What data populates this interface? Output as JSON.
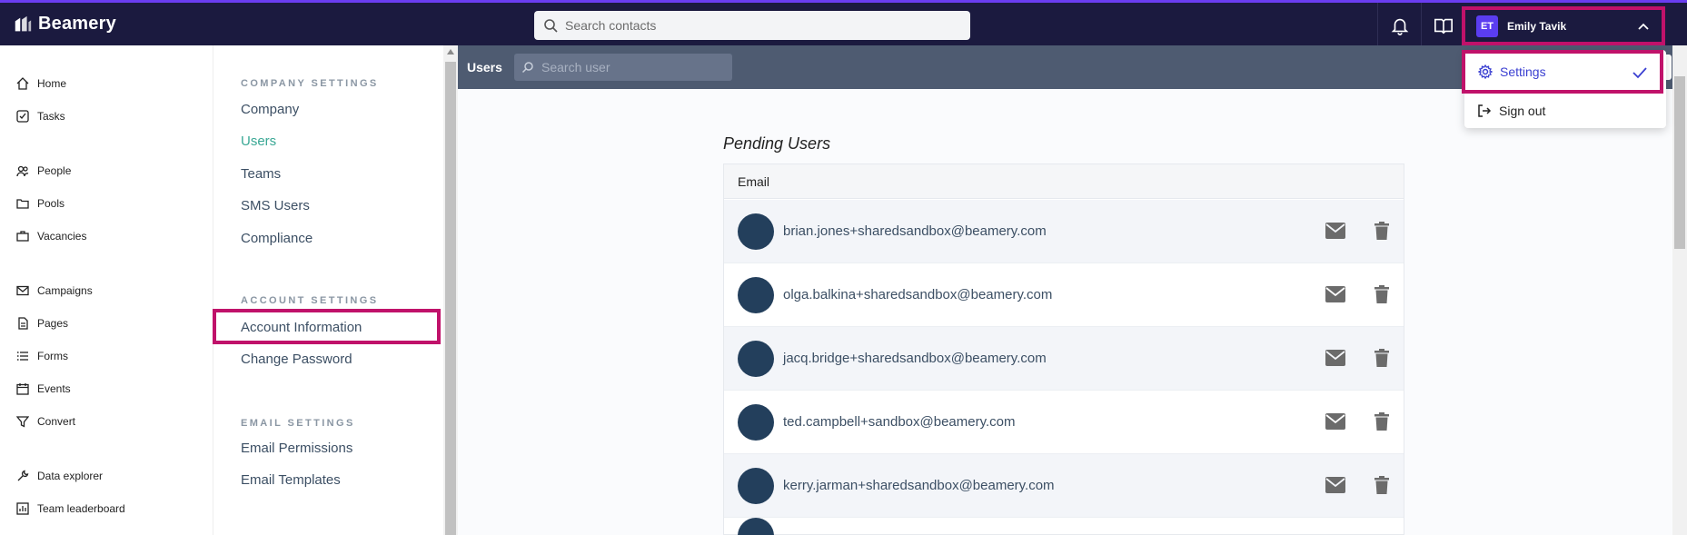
{
  "app": {
    "brand": "Beamery"
  },
  "topbar": {
    "search_placeholder": "Search contacts",
    "user": {
      "initials": "ET",
      "name": "Emily Tavik"
    }
  },
  "leftnav": {
    "items": [
      {
        "label": "Home",
        "icon": "home-icon"
      },
      {
        "label": "Tasks",
        "icon": "tasks-icon"
      },
      {
        "label": "People",
        "icon": "people-icon"
      },
      {
        "label": "Pools",
        "icon": "folder-icon"
      },
      {
        "label": "Vacancies",
        "icon": "briefcase-icon"
      },
      {
        "label": "Campaigns",
        "icon": "mail-icon"
      },
      {
        "label": "Pages",
        "icon": "page-icon"
      },
      {
        "label": "Forms",
        "icon": "list-icon"
      },
      {
        "label": "Events",
        "icon": "calendar-icon"
      },
      {
        "label": "Convert",
        "icon": "funnel-icon"
      },
      {
        "label": "Data explorer",
        "icon": "wrench-icon"
      },
      {
        "label": "Team leaderboard",
        "icon": "chart-icon"
      }
    ]
  },
  "settings": {
    "company_heading": "COMPANY SETTINGS",
    "company_links": [
      "Company",
      "Users",
      "Teams",
      "SMS Users",
      "Compliance"
    ],
    "active_link": "Users",
    "account_heading": "ACCOUNT SETTINGS",
    "account_links": [
      "Account Information",
      "Change Password"
    ],
    "email_heading": "EMAIL SETTINGS",
    "email_links": [
      "Email Permissions",
      "Email Templates"
    ]
  },
  "subbar": {
    "title": "Users",
    "search_placeholder": "Search user"
  },
  "main": {
    "section_title": "Pending Users",
    "column_header": "Email",
    "rows": [
      "brian.jones+sharedsandbox@beamery.com",
      "olga.balkina+sharedsandbox@beamery.com",
      "jacq.bridge+sharedsandbox@beamery.com",
      "ted.campbell+sandbox@beamery.com",
      "kerry.jarman+sharedsandbox@beamery.com"
    ]
  },
  "dropdown": {
    "settings_label": "Settings",
    "signout_label": "Sign out"
  },
  "colors": {
    "topbar": "#1b1a3f",
    "accent": "#6a3df0",
    "active_link": "#3aa895",
    "highlight": "#c0126a",
    "avatar": "#233f5c"
  }
}
